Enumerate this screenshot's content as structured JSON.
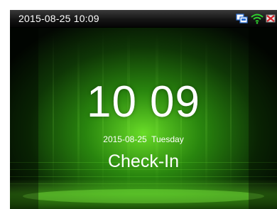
{
  "statusbar": {
    "datetime": "2015-08-25 10:09",
    "icons": [
      "network-icon",
      "wifi-icon",
      "usb-icon"
    ]
  },
  "clock": {
    "hours": "10",
    "minutes": "09",
    "date": "2015-08-25",
    "weekday": "Tuesday"
  },
  "attendance": {
    "state": "Check-In"
  },
  "colors": {
    "background": "#050d03",
    "glow": "#4fd61a",
    "text": "#ffffff",
    "statusbar": "#151515"
  }
}
